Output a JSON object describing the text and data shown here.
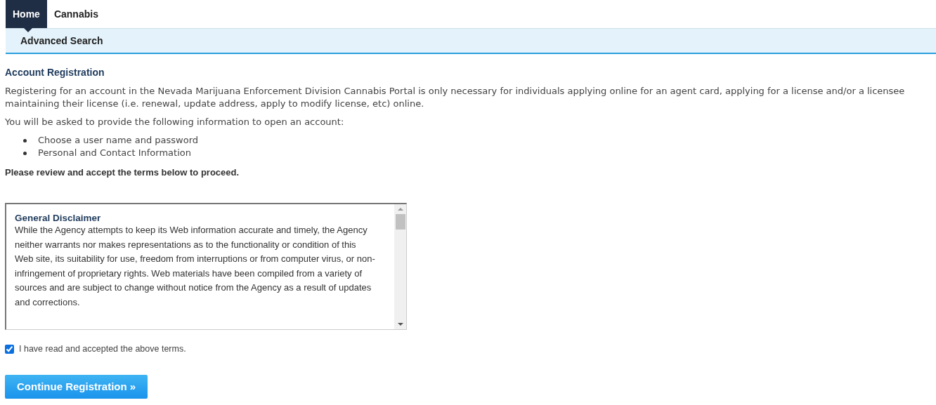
{
  "tabs": [
    {
      "label": "Home",
      "selected": true
    },
    {
      "label": "Cannabis",
      "selected": false
    }
  ],
  "subnav": {
    "items": [
      "Advanced Search"
    ]
  },
  "heading": "Account Registration",
  "intro": "Registering for an account in the Nevada Marijuana Enforcement Division Cannabis Portal is only necessary for individuals applying online for an agent card, applying for a license and/or a licensee maintaining their license (i.e. renewal, update address, apply to modify license, etc) online.",
  "info_text": "You will be asked to provide the following information to open an account:",
  "requirements": [
    "Choose a user name and password",
    "Personal and Contact Information"
  ],
  "instruction": "Please review and accept the terms below to proceed.",
  "terms": {
    "title": "General Disclaimer",
    "body": "While the Agency attempts to keep its Web information accurate and timely, the Agency neither warrants nor makes representations as to the functionality or condition of this Web site, its suitability for use, freedom from interruptions or from computer virus, or non-infringement of proprietary rights. Web materials have been compiled from a variety of sources and are subject to change without notice from the Agency as a result of updates and corrections."
  },
  "accept": {
    "label": "I have read and accepted the above terms.",
    "checked": true
  },
  "continue_button": "Continue Registration »"
}
